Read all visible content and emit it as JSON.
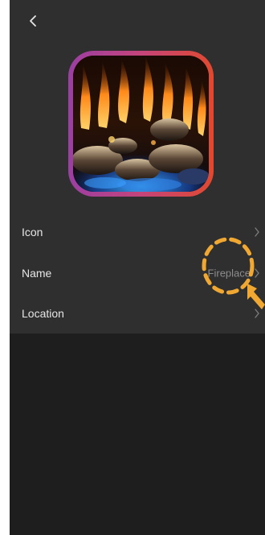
{
  "header": {
    "back_icon": "chevron-left-icon"
  },
  "device_icon": {
    "image": "fireplace-flames-photo"
  },
  "settings": {
    "rows": [
      {
        "label": "Icon",
        "value": "",
        "icon": "chevron-right-icon"
      },
      {
        "label": "Name",
        "value": "Fireplace",
        "icon": "chevron-right-icon"
      },
      {
        "label": "Location",
        "value": "",
        "icon": "chevron-right-icon"
      }
    ]
  },
  "annotation": {
    "circle_color": "#f0a832",
    "arrow_color": "#f0a832"
  },
  "colors": {
    "background": "#1e1e1e",
    "panel": "#2f2f2f",
    "frame_gradient": [
      "#9b3fa3",
      "#c5447a",
      "#e0492f"
    ]
  }
}
